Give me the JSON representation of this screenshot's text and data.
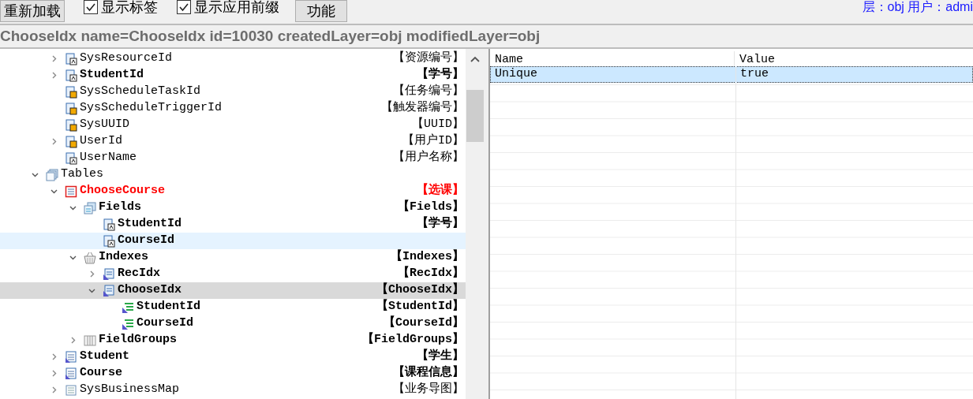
{
  "toolbar": {
    "buttons": [
      {
        "label": "重新加载"
      }
    ],
    "checkboxes": [
      {
        "label": "显示标签",
        "checked": true
      },
      {
        "label": "显示应用前缀",
        "checked": true
      }
    ],
    "function_button": "功能",
    "status": "层：obj 用户：admi"
  },
  "title_bar": "ChooseIdx name=ChooseIdx id=10030 createdLayer=obj modifiedLayer=obj",
  "tree": {
    "partial_items": [
      {
        "name": "SysResourceId",
        "label": "【资源编号】",
        "kind": "key-field",
        "bold": false,
        "red": false,
        "selected": false,
        "hovered": false,
        "expanded": false
      },
      {
        "name": "StudentId",
        "label": "【学号】",
        "kind": "key-field",
        "bold": true,
        "red": false,
        "selected": false,
        "hovered": false,
        "expanded": false
      },
      {
        "name": "SysScheduleTaskId",
        "label": "【任务编号】",
        "kind": "lock-field",
        "bold": false,
        "red": false,
        "selected": false,
        "hovered": false
      },
      {
        "name": "SysScheduleTriggerId",
        "label": "【触发器编号】",
        "kind": "lock-field",
        "bold": false,
        "red": false,
        "selected": false,
        "hovered": false
      },
      {
        "name": "SysUUID",
        "label": "【UUID】",
        "kind": "lock-field",
        "bold": false,
        "red": false,
        "selected": false,
        "hovered": false
      },
      {
        "name": "UserId",
        "label": "【用户ID】",
        "kind": "lock-field",
        "bold": false,
        "red": false,
        "selected": false,
        "hovered": false,
        "expanded": false
      },
      {
        "name": "UserName",
        "label": "【用户名称】",
        "kind": "key-field",
        "bold": false,
        "red": false,
        "selected": false,
        "hovered": false
      }
    ],
    "items": [
      {
        "name": "Tables",
        "kind": "tables",
        "bold": false,
        "red": false,
        "selected": false,
        "hovered": false,
        "expanded": true,
        "children": [
          {
            "name": "ChooseCourse",
            "label": "【选课】",
            "kind": "table-red",
            "bold": true,
            "red": true,
            "selected": false,
            "hovered": false,
            "expanded": true,
            "children": [
              {
                "name": "Fields",
                "label": "【Fields】",
                "kind": "fields",
                "bold": true,
                "red": false,
                "selected": false,
                "hovered": false,
                "expanded": true,
                "children": [
                  {
                    "name": "StudentId",
                    "label": "【学号】",
                    "kind": "key-field",
                    "bold": true,
                    "red": false,
                    "selected": false,
                    "hovered": false
                  },
                  {
                    "name": "CourseId",
                    "kind": "key-field",
                    "bold": true,
                    "red": false,
                    "selected": false,
                    "hovered": true
                  }
                ]
              },
              {
                "name": "Indexes",
                "label": "【Indexes】",
                "kind": "indexes",
                "bold": true,
                "red": false,
                "selected": false,
                "hovered": false,
                "expanded": true,
                "children": [
                  {
                    "name": "RecIdx",
                    "label": "【RecIdx】",
                    "kind": "index",
                    "bold": true,
                    "red": false,
                    "selected": false,
                    "hovered": false,
                    "expanded": false
                  },
                  {
                    "name": "ChooseIdx",
                    "label": "【ChooseIdx】",
                    "kind": "index",
                    "bold": true,
                    "red": false,
                    "selected": true,
                    "hovered": false,
                    "expanded": true,
                    "children": [
                      {
                        "name": "StudentId",
                        "label": "【StudentId】",
                        "kind": "index-field",
                        "bold": true,
                        "red": false,
                        "selected": false,
                        "hovered": false
                      },
                      {
                        "name": "CourseId",
                        "label": "【CourseId】",
                        "kind": "index-field",
                        "bold": true,
                        "red": false,
                        "selected": false,
                        "hovered": false
                      }
                    ]
                  }
                ]
              },
              {
                "name": "FieldGroups",
                "label": "【FieldGroups】",
                "kind": "field-groups",
                "bold": true,
                "red": false,
                "selected": false,
                "hovered": false,
                "expanded": false
              }
            ]
          },
          {
            "name": "Student",
            "label": "【学生】",
            "kind": "table",
            "bold": true,
            "red": false,
            "selected": false,
            "hovered": false,
            "expanded": false
          },
          {
            "name": "Course",
            "label": "【课程信息】",
            "kind": "table",
            "bold": true,
            "red": false,
            "selected": false,
            "hovered": false,
            "expanded": false
          },
          {
            "name": "SysBusinessMap",
            "label": "【业务导图】",
            "kind": "table-plain",
            "bold": false,
            "red": false,
            "selected": false,
            "hovered": false,
            "expanded": false
          }
        ]
      }
    ]
  },
  "properties": {
    "columns": [
      "Name",
      "Value"
    ],
    "rows": [
      {
        "name": "Unique",
        "value": "true",
        "selected": true
      }
    ]
  }
}
